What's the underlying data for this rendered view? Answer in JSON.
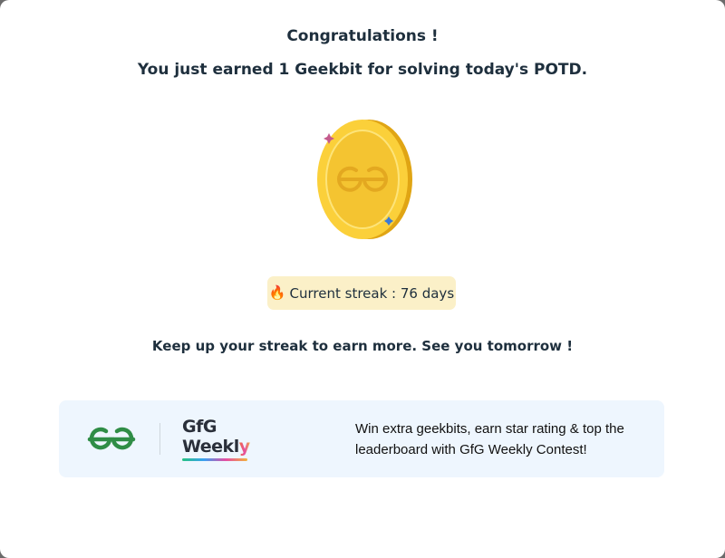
{
  "modal": {
    "title": "Congratulations !",
    "subtitle": "You just earned 1 Geekbit for solving today's POTD.",
    "coin_icon": "geekbit-coin-icon",
    "streak": {
      "icon": "fire-icon",
      "emoji": "🔥",
      "label": "Current streak : 76 days"
    },
    "message": "Keep up your streak to earn more. See you tomorrow !"
  },
  "banner": {
    "logo_icon": "gfg-logo-icon",
    "weekly_line1": "GfG",
    "weekly_line2_main": "Weekl",
    "weekly_line2_accent": "y",
    "text": "Win extra geekbits, earn star rating & top the leaderboard with GfG Weekly Contest!"
  },
  "colors": {
    "text": "#1e2f3d",
    "coin": "#f7c52b",
    "streak_bg": "#fbf0c8",
    "banner_bg": "#eef6fe",
    "gfg_green": "#2f8d46"
  }
}
